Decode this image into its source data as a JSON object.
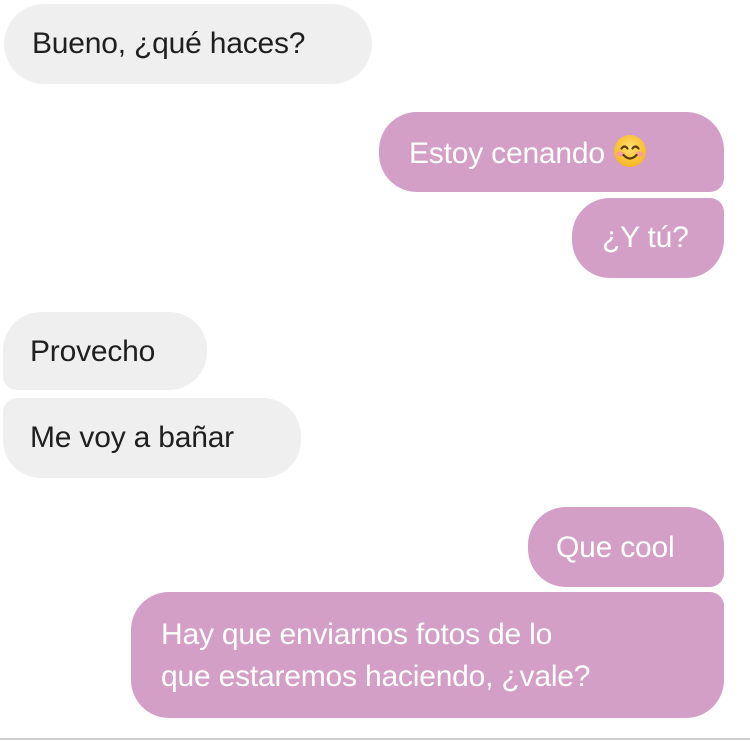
{
  "conversation": {
    "messages": [
      {
        "sender": "other",
        "lines": [
          "Bueno, ¿qué haces?"
        ]
      },
      {
        "sender": "me",
        "lines": [
          "Estoy cenando"
        ],
        "emoji": "smiling-face-with-smiling-eyes-icon"
      },
      {
        "sender": "me",
        "lines": [
          "¿Y tú?"
        ]
      },
      {
        "sender": "other",
        "lines": [
          "Provecho"
        ]
      },
      {
        "sender": "other",
        "lines": [
          "Me voy a bañar"
        ]
      },
      {
        "sender": "me",
        "lines": [
          "Que cool"
        ]
      },
      {
        "sender": "me",
        "lines": [
          "Hay que enviarnos fotos de lo",
          "que estaremos haciendo, ¿vale?"
        ]
      }
    ]
  },
  "colors": {
    "received_bubble": "#efefef",
    "received_text": "#1f1f1f",
    "sent_bubble": "#d39fc7",
    "sent_text": "#ffffff",
    "background": "#ffffff"
  }
}
